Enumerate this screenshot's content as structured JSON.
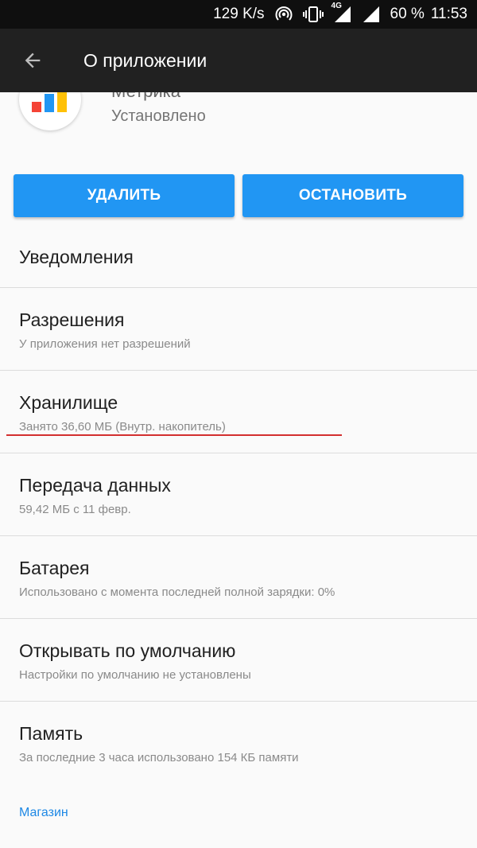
{
  "status_bar": {
    "speed": "129 K/s",
    "network": "4G",
    "battery": "60 %",
    "time": "11:53"
  },
  "app_bar": {
    "title": "О приложении"
  },
  "app": {
    "name": "Метрика",
    "state": "Установлено"
  },
  "buttons": {
    "uninstall": "УДАЛИТЬ",
    "stop": "ОСТАНОВИТЬ"
  },
  "list": [
    {
      "title": "Уведомления",
      "subtitle": ""
    },
    {
      "title": "Разрешения",
      "subtitle": "У приложения нет разрешений"
    },
    {
      "title": "Хранилище",
      "subtitle": "Занято 36,60 МБ (Внутр. накопитель)"
    },
    {
      "title": "Передача данных",
      "subtitle": "59,42 МБ с 11 февр."
    },
    {
      "title": "Батарея",
      "subtitle": "Использовано с момента последней полной зарядки: 0%"
    },
    {
      "title": "Открывать по умолчанию",
      "subtitle": "Настройки по умолчанию не установлены"
    },
    {
      "title": "Память",
      "subtitle": "За последние 3 часа использовано 154 КБ памяти"
    }
  ],
  "store": {
    "label": "Магазин"
  },
  "colors": {
    "accent": "#2196f3",
    "app_bar": "#212121",
    "status_bar": "#0f0f0f",
    "highlight": "#d32f2f",
    "link": "#1e88e5"
  },
  "icons": {
    "back": "arrow-back-icon",
    "hotspot": "hotspot-icon",
    "vibrate": "vibrate-icon",
    "signal": "signal-icon",
    "app": "metrica-logo-icon"
  }
}
